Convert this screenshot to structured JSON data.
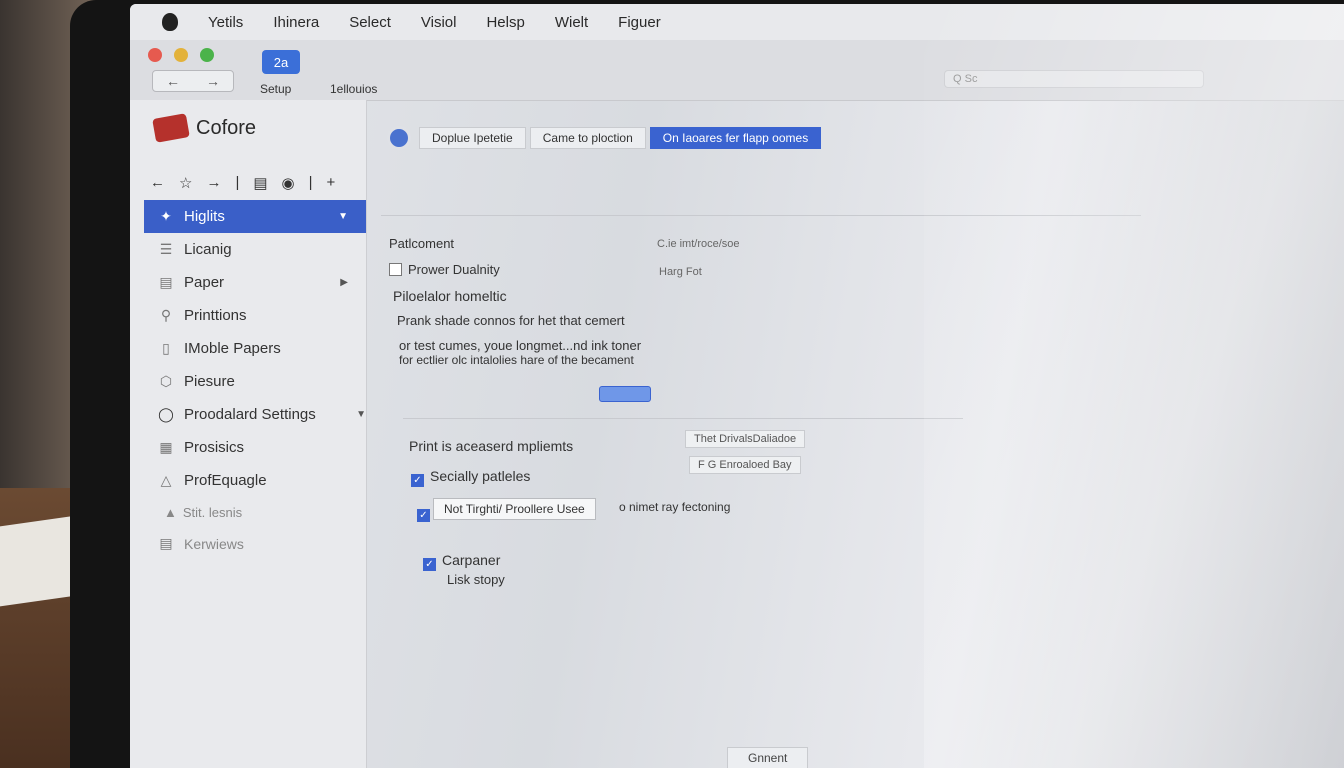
{
  "menubar": {
    "items": [
      "Yetils",
      "Ihinera",
      "Select",
      "Visiol",
      "Helsp",
      "Wielt",
      "Figuer"
    ]
  },
  "toolbar": {
    "badge": "2a",
    "label1": "Setup",
    "label2": "1ellouios",
    "traffic_colors": [
      "#e65a4f",
      "#e3b23b",
      "#4bb34a"
    ]
  },
  "sidebar": {
    "brand": "Cofore",
    "items": [
      {
        "label": "Higlits",
        "active": true
      },
      {
        "label": "Licanig"
      },
      {
        "label": "Paper"
      },
      {
        "label": "Printtions"
      },
      {
        "label": "IMoble Papers"
      },
      {
        "label": "Piesure"
      },
      {
        "label": "Proodalard Settings"
      },
      {
        "label": "Prosisics"
      },
      {
        "label": "ProfEquagle"
      }
    ],
    "section": "Stit. lesnis",
    "extra": "Kerwiews"
  },
  "main": {
    "tabs": [
      "Doplue Ipetetie",
      "Came to ploction",
      "On Iaoares fer flapp oomes"
    ],
    "placement": "Patlcoment",
    "placement_right": "C.ie imt/roce/soe",
    "power_duality": "Prower Dualnity",
    "power_right": "Harg Fot",
    "heading1": "Piloelalor homeltic",
    "desc1": "Prank shade connos for het that cemert",
    "desc2": "or test cumes, youe longmet...nd ink toner",
    "desc3": "for ectlier olc intalolies hare of the becament",
    "print_heading": "Print is aceaserd mpliemts",
    "print_pill1": "Thet DrivalsDaliadoe",
    "print_pill2": "F G Enroaloed Bay",
    "chk1": "Secially patleles",
    "input_label": "Not Tirghti/ Proollere Usee",
    "input_suffix": "o nimet ray fectoning",
    "chk3": "Carpaner",
    "chk3_sub": "Lisk stopy",
    "bottom_tab": "Gnnent",
    "search_placeholder": "Q Sc"
  }
}
